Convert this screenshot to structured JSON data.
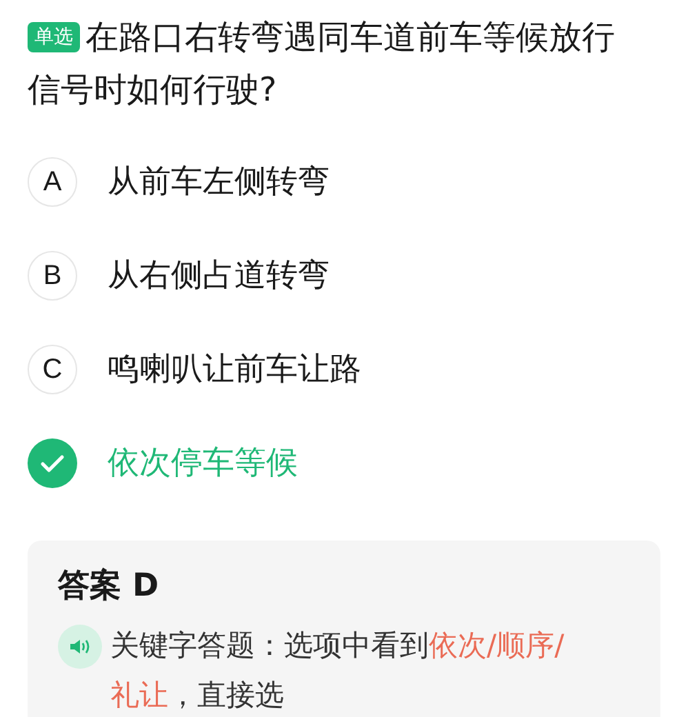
{
  "question": {
    "badge": "单选",
    "text": "在路口右转弯遇同车道前车等候放行信号时如何行驶?"
  },
  "options": [
    {
      "letter": "A",
      "text": "从前车左侧转弯",
      "selected": false
    },
    {
      "letter": "B",
      "text": "从右侧占道转弯",
      "selected": false
    },
    {
      "letter": "C",
      "text": "鸣喇叭让前车让路",
      "selected": false
    },
    {
      "text": "依次停车等候",
      "selected": true
    }
  ],
  "answer": {
    "title": "答案 D",
    "tip": [
      {
        "text": "关键字答题：选项中看到",
        "highlight": false
      },
      {
        "text": "依次/顺序/礼让",
        "highlight": true
      },
      {
        "text": "，直接选",
        "highlight": false
      }
    ]
  }
}
